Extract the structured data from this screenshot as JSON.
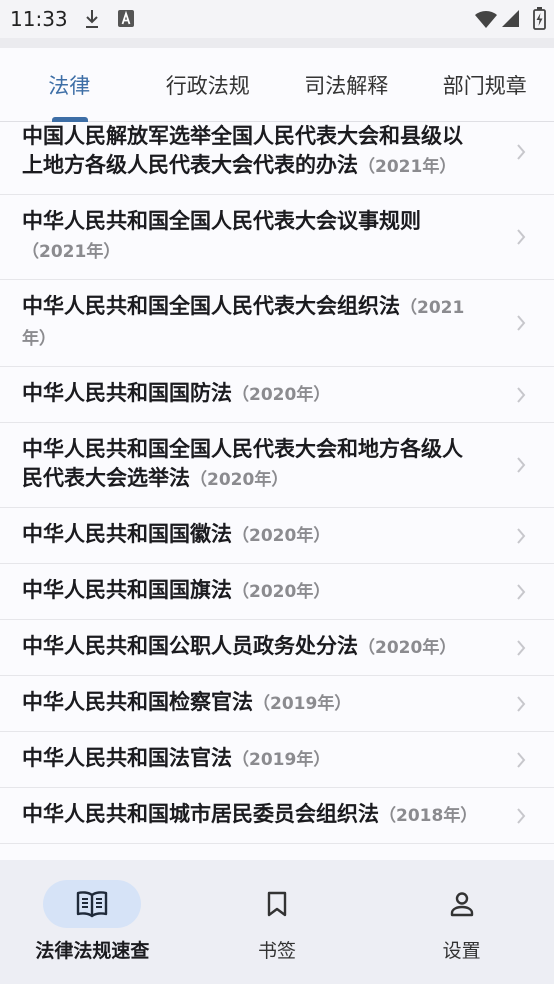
{
  "status_bar": {
    "time": "11:33",
    "icons": [
      "download-icon",
      "text-a-icon",
      "wifi-icon",
      "signal-icon",
      "battery-charging-icon"
    ]
  },
  "tabs": [
    {
      "label": "法律",
      "selected": true
    },
    {
      "label": "行政法规",
      "selected": false
    },
    {
      "label": "司法解释",
      "selected": false
    },
    {
      "label": "部门规章",
      "selected": false
    }
  ],
  "laws": [
    {
      "title": "中国人民解放军选举全国人民代表大会和县级以上地方各级人民代表大会代表的办法",
      "year": "（2021年）"
    },
    {
      "title": "中华人民共和国全国人民代表大会议事规则",
      "year": "（2021年）"
    },
    {
      "title": "中华人民共和国全国人民代表大会组织法",
      "year": "（2021年）"
    },
    {
      "title": "中华人民共和国国防法",
      "year": "（2020年）"
    },
    {
      "title": "中华人民共和国全国人民代表大会和地方各级人民代表大会选举法",
      "year": "（2020年）"
    },
    {
      "title": "中华人民共和国国徽法",
      "year": "（2020年）"
    },
    {
      "title": "中华人民共和国国旗法",
      "year": "（2020年）"
    },
    {
      "title": "中华人民共和国公职人员政务处分法",
      "year": "（2020年）"
    },
    {
      "title": "中华人民共和国检察官法",
      "year": "（2019年）"
    },
    {
      "title": "中华人民共和国法官法",
      "year": "（2019年）"
    },
    {
      "title": "中华人民共和国城市居民委员会组织法",
      "year": "（2018年）"
    }
  ],
  "bottom_nav": [
    {
      "label": "法律法规速查",
      "icon": "book-open-icon",
      "selected": true
    },
    {
      "label": "书签",
      "icon": "bookmark-icon",
      "selected": false
    },
    {
      "label": "设置",
      "icon": "person-icon",
      "selected": false
    }
  ],
  "colors": {
    "accent": "#3d6ea6",
    "nav_pill": "#d6e3f7",
    "nav_background": "#edeef4",
    "year_text": "#8b8b8f"
  }
}
